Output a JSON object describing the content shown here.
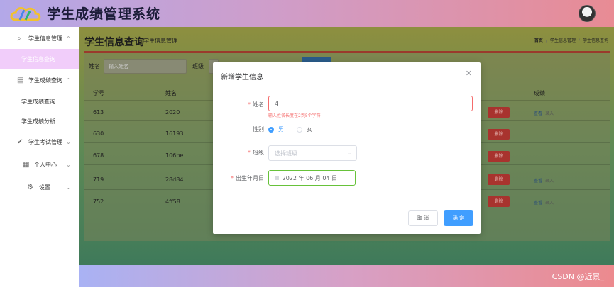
{
  "header": {
    "app_title": "学生成绩管理系统"
  },
  "sidebar": {
    "groups": [
      {
        "label": "学生信息管理",
        "icon": "search-icon",
        "expanded": true,
        "children": [
          {
            "label": "学生信息查询",
            "active": true
          }
        ]
      },
      {
        "label": "学生成绩查询",
        "icon": "document-icon",
        "expanded": true,
        "children": [
          {
            "label": "学生成绩查询"
          },
          {
            "label": "学生成绩分析"
          }
        ]
      },
      {
        "label": "学生考试管理",
        "icon": "check-circle-icon"
      },
      {
        "label": "个人中心",
        "icon": "grid-icon"
      },
      {
        "label": "设置",
        "icon": "gear-icon"
      }
    ]
  },
  "main": {
    "title": "学生信息查询",
    "subtitle": "学生信息管理",
    "breadcrumb": [
      "首页",
      "学生信息管理",
      "学生信息查询"
    ],
    "filters": {
      "name_label": "姓名",
      "name_placeholder": "输入姓名",
      "class_label": "班级"
    },
    "table": {
      "columns": [
        "学号",
        "姓名",
        "成绩"
      ],
      "rows": [
        {
          "id": "613",
          "name": "2020"
        },
        {
          "id": "630",
          "name": "16193"
        },
        {
          "id": "678",
          "name": "106be"
        },
        {
          "id": "719",
          "name": "28d84"
        },
        {
          "id": "752",
          "name": "4ff58"
        }
      ],
      "delete_label": "删除",
      "view_label": "查看",
      "enter_label": "录入"
    }
  },
  "modal": {
    "title": "新增学生信息",
    "fields": {
      "name_label": "姓名",
      "name_value": "4",
      "name_error": "输入姓名长度在2到5个字符",
      "gender_label": "性别",
      "gender_options": [
        "男",
        "女"
      ],
      "gender_selected": "男",
      "class_label": "班级",
      "class_placeholder": "选择班级",
      "birth_label": "出生年月日",
      "birth_value": "2022 年 06 月 04 日"
    },
    "cancel_label": "取 消",
    "confirm_label": "确 定"
  },
  "footer": {
    "watermark": "CSDN @近景_"
  },
  "colors": {
    "primary": "#409eff",
    "danger": "#f56c6c",
    "success": "#67c23a",
    "active_menu_bg": "#f1cdfa"
  }
}
